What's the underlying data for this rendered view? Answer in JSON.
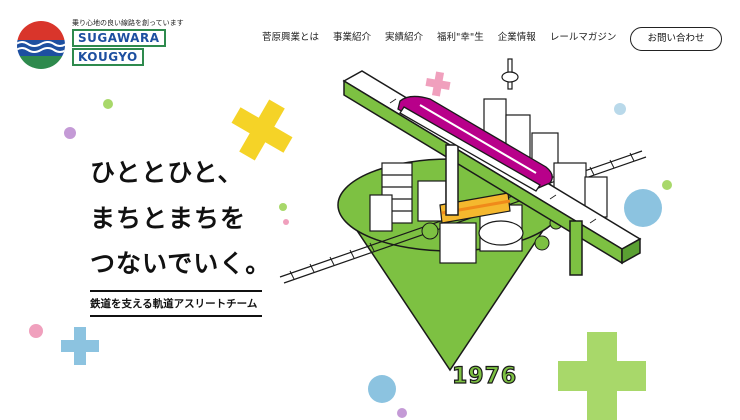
{
  "logo": {
    "tagline": "乗り心地の良い線路を創っています",
    "word1": "SUGAWARA",
    "word2": "KOUGYO"
  },
  "nav": {
    "items": [
      "菅原興業とは",
      "事業紹介",
      "実績紹介",
      "福利\"幸\"生",
      "企業情報",
      "レールマガジン"
    ],
    "contact": "お問い合わせ"
  },
  "hero": {
    "line1": "ひととひと、",
    "line2": "まちとまちを",
    "line3": "つないでいく。",
    "subtitle": "鉄道を支える軌道アスリートチーム",
    "year": "1976"
  },
  "colors": {
    "green": "#7dc142",
    "yellow": "#f5d327",
    "pink": "#f0a0bd",
    "purple": "#b45ab8",
    "lightblue": "#8cc3e0",
    "magenta": "#b8008a",
    "logo_red": "#d9352b",
    "logo_blue": "#1d4fa0"
  }
}
